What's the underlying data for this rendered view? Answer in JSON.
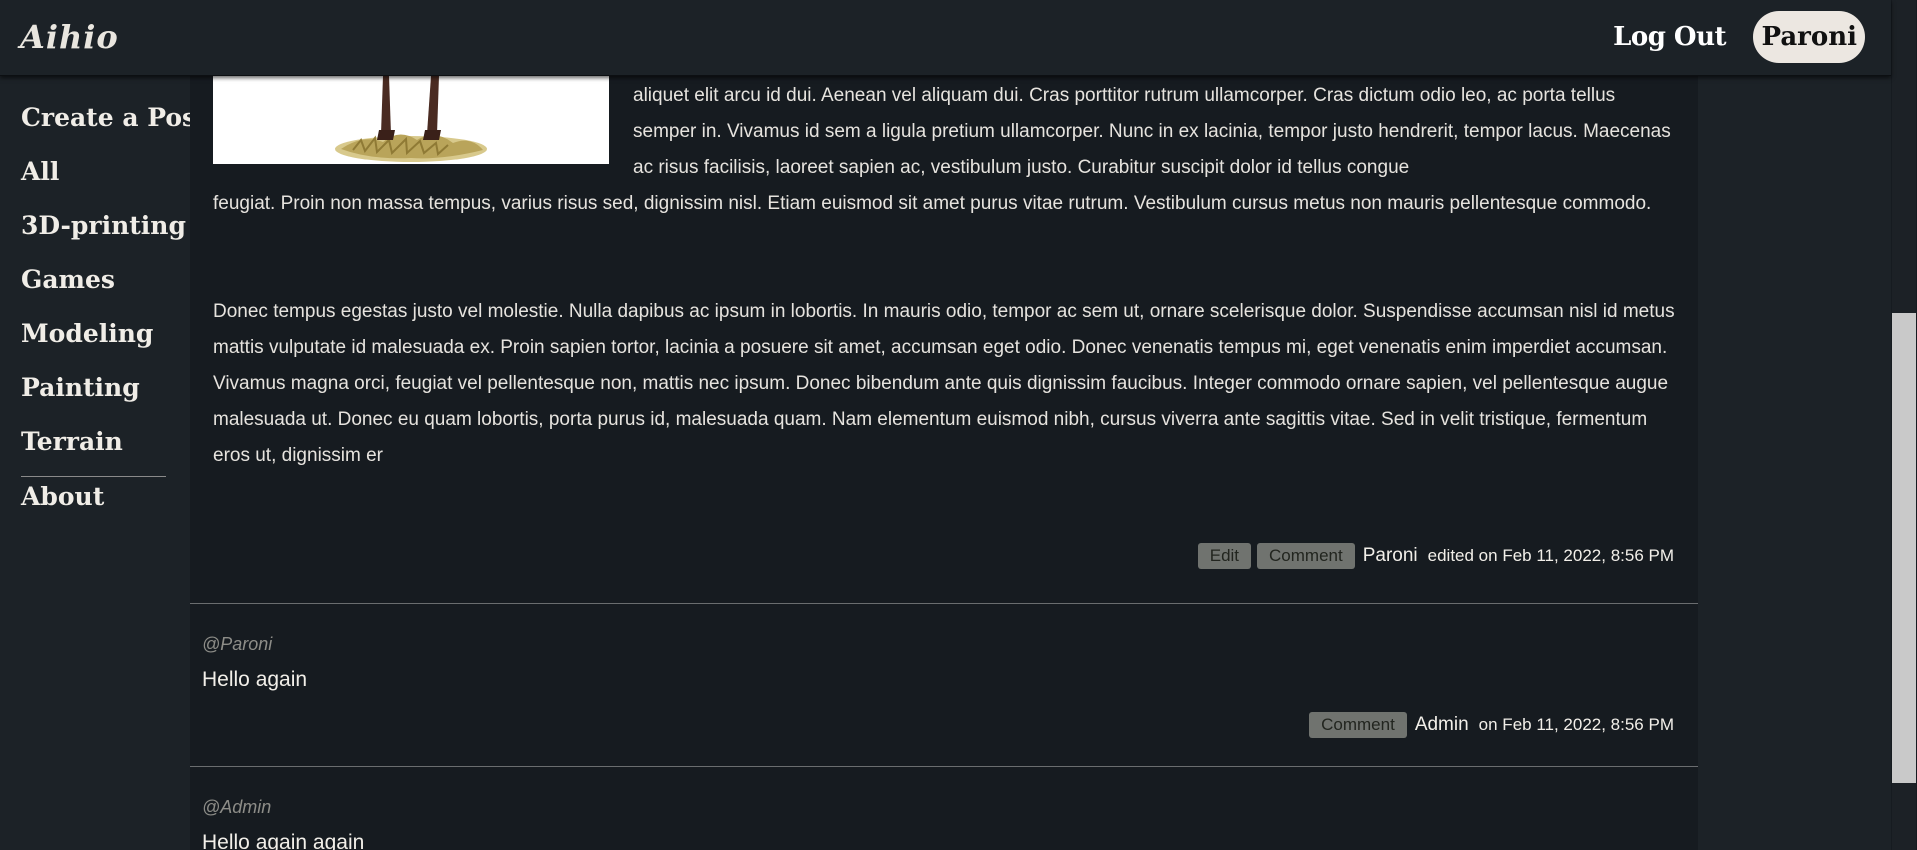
{
  "header": {
    "logo": "Aihio",
    "logout_label": "Log Out",
    "username": "Paroni"
  },
  "sidebar": {
    "items": [
      {
        "label": "Create a Post"
      },
      {
        "label": "All"
      },
      {
        "label": "3D-printing"
      },
      {
        "label": "Games"
      },
      {
        "label": "Modeling"
      },
      {
        "label": "Painting"
      },
      {
        "label": "Terrain"
      }
    ],
    "about_label": "About"
  },
  "post": {
    "paragraph1_beside_image": "aliquet elit arcu id dui. Aenean vel aliquam dui. Cras porttitor rutrum ullamcorper. Cras dictum odio leo, ac porta tellus semper in. Vivamus id sem a ligula pretium ullamcorper. Nunc in ex lacinia, tempor justo hendrerit, tempor lacus. Maecenas ac risus facilisis, laoreet sapien ac, vestibulum justo. Curabitur suscipit dolor id tellus congue",
    "paragraph1_continued": "feugiat. Proin non massa tempus, varius risus sed, dignissim nisl. Etiam euismod sit amet purus vitae rutrum. Vestibulum cursus metus non mauris pellentesque commodo.",
    "paragraph2": "Donec tempus egestas justo vel molestie. Nulla dapibus ac ipsum in lobortis. In mauris odio, tempor ac sem ut, ornare scelerisque dolor. Suspendisse accumsan nisl id metus mattis vulputate id malesuada ex. Proin sapien tortor, lacinia a posuere sit amet, accumsan eget odio. Donec venenatis tempus mi, eget venenatis enim imperdiet accumsan. Vivamus magna orci, feugiat vel pellentesque non, mattis nec ipsum. Donec bibendum ante quis dignissim faucibus. Integer commodo ornare sapien, vel pellentesque augue malesuada ut. Donec eu quam lobortis, porta purus id, malesuada quam. Nam elementum euismod nibh, cursus viverra ante sagittis vitae. Sed in velit tristique, fermentum eros ut, dignissim er",
    "edit_label": "Edit",
    "comment_label": "Comment",
    "author": "Paroni",
    "date": "edited on Feb 11, 2022, 8:56 PM"
  },
  "comments": [
    {
      "mention": "@Paroni",
      "text": "Hello again",
      "comment_label": "Comment",
      "author": "Admin",
      "date": "on Feb 11, 2022, 8:56 PM"
    },
    {
      "mention": "@Admin",
      "text": "Hello again again"
    }
  ]
}
